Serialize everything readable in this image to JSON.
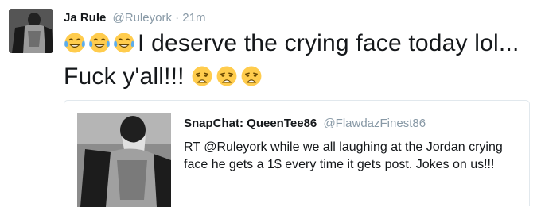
{
  "tweet": {
    "author_name": "Ja Rule",
    "author_handle": "@Ruleyork",
    "separator": "·",
    "time": "21m",
    "text_part1": "I deserve the crying face today lol... Fuck y'all!!!",
    "leading_emoji": [
      "tears-of-joy-icon",
      "tears-of-joy-icon",
      "tears-of-joy-icon"
    ],
    "trailing_emoji": [
      "weary-face-icon",
      "weary-face-icon",
      "weary-face-icon"
    ]
  },
  "quoted_tweet": {
    "author_name": "SnapChat: QueenTee86",
    "author_handle": "@FlawdazFinest86",
    "text": "RT @Ruleyork while we all laughing at the Jordan crying face he gets a 1$ every time it gets post. Jokes on us!!!"
  },
  "colors": {
    "emoji_yellow": "#ffcc4d",
    "tear_blue": "#5dadec",
    "muted": "#8899a6",
    "border": "#e1e8ed"
  }
}
